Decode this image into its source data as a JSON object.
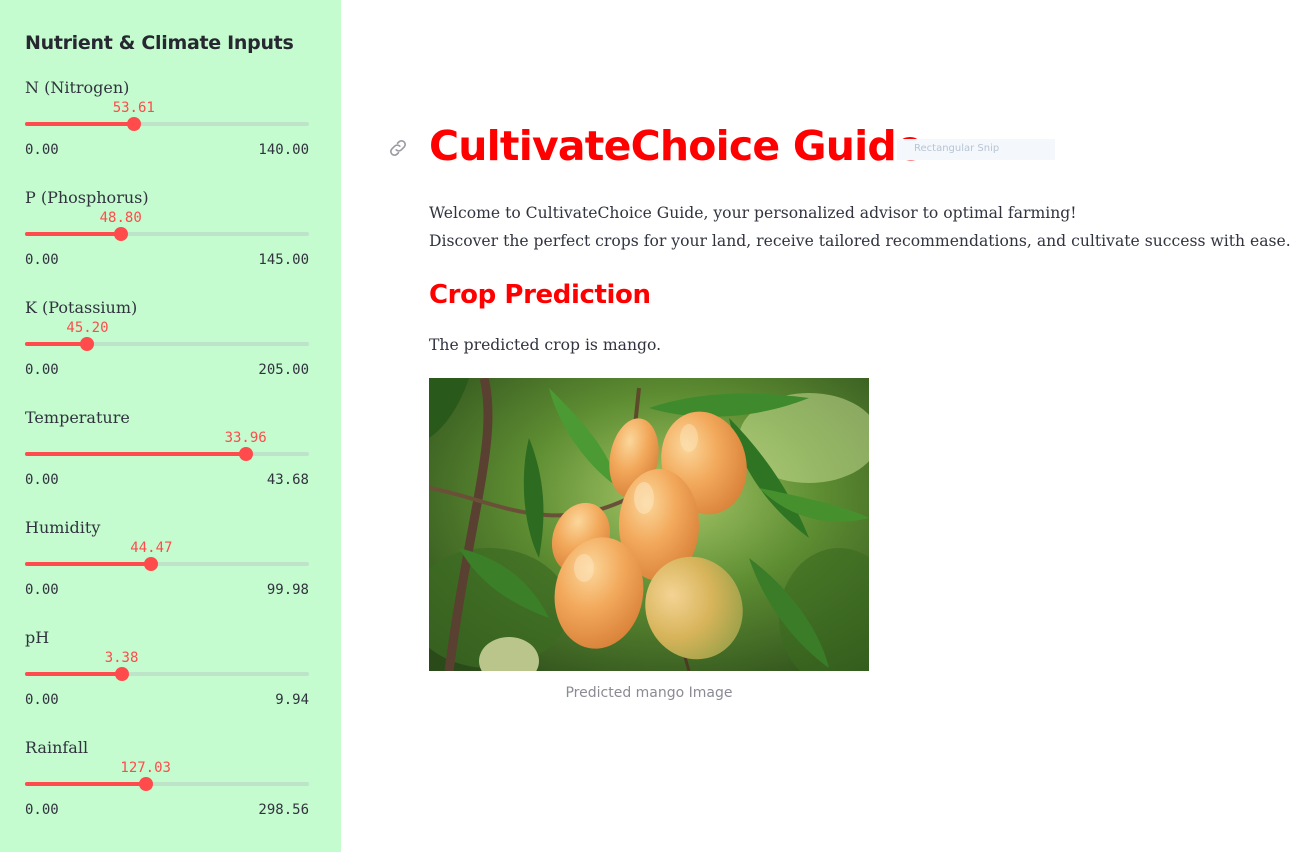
{
  "sidebar": {
    "title": "Nutrient & Climate Inputs",
    "sliders": [
      {
        "label": "N (Nitrogen)",
        "value": "53.61",
        "min": "0.00",
        "max": "140.00",
        "fraction": 0.383
      },
      {
        "label": "P (Phosphorus)",
        "value": "48.80",
        "min": "0.00",
        "max": "145.00",
        "fraction": 0.337
      },
      {
        "label": "K (Potassium)",
        "value": "45.20",
        "min": "0.00",
        "max": "205.00",
        "fraction": 0.22
      },
      {
        "label": "Temperature",
        "value": "33.96",
        "min": "0.00",
        "max": "43.68",
        "fraction": 0.777
      },
      {
        "label": "Humidity",
        "value": "44.47",
        "min": "0.00",
        "max": "99.98",
        "fraction": 0.445
      },
      {
        "label": "pH",
        "value": "3.38",
        "min": "0.00",
        "max": "9.94",
        "fraction": 0.34
      },
      {
        "label": "Rainfall",
        "value": "127.03",
        "min": "0.00",
        "max": "298.56",
        "fraction": 0.425
      }
    ]
  },
  "main": {
    "title": "CultivateChoice Guide",
    "snip_overlay": "Rectangular Snip",
    "intro_line1": "Welcome to CultivateChoice Guide, your personalized advisor to optimal farming!",
    "intro_line2": "Discover the perfect crops for your land, receive tailored recommendations, and cultivate success with ease.",
    "section_title": "Crop Prediction",
    "prediction_text": "The predicted crop is mango.",
    "image_caption": "Predicted mango Image"
  },
  "icons": {
    "anchor_link": "link-icon",
    "photo": "mango-photo"
  },
  "colors": {
    "sidebar_bg": "#c5fccf",
    "accent": "#ff4b4b",
    "title_red": "#ff0000"
  }
}
